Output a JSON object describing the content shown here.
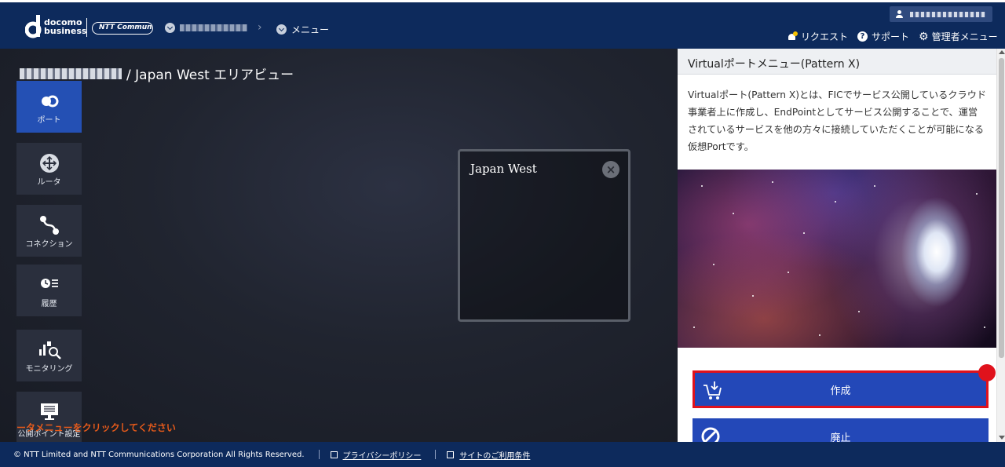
{
  "header": {
    "logo": {
      "line1": "docomo",
      "line2": "business",
      "partner": "NTT Communications"
    },
    "breadcrumb": {
      "menu": "メニュー"
    },
    "links": {
      "request": "リクエスト",
      "support": "サポート",
      "admin_menu": "管理者メニュー"
    },
    "icons": {
      "request": "bell-icon",
      "support": "question-icon",
      "admin": "gear-icon",
      "user": "user-icon"
    }
  },
  "main": {
    "title_suffix": "/ Japan West エリアビュー",
    "sidebar": [
      {
        "key": "port",
        "label": "ポート",
        "icon": "port-icon",
        "active": true
      },
      {
        "key": "router",
        "label": "ルータ",
        "icon": "router-icon",
        "active": false
      },
      {
        "key": "connection",
        "label": "コネクション",
        "icon": "connection-icon",
        "active": false
      },
      {
        "key": "history",
        "label": "履歴",
        "icon": "history-icon",
        "active": false
      },
      {
        "key": "monitoring",
        "label": "モニタリング",
        "icon": "monitoring-icon",
        "active": false
      },
      {
        "key": "public_point",
        "label": "公開ポイント設定",
        "icon": "monitor-icon",
        "active": false
      }
    ],
    "hint": "ータメニューをクリックしてください",
    "area": {
      "name": "Japan West",
      "close_icon": "close-icon"
    }
  },
  "panel": {
    "title": "Virtualポートメニュー(Pattern X)",
    "description": "Virtualポート(Pattern X)とは、FICでサービス公開しているクラウド事業者上に作成し、EndPointとしてサービス公開することで、運営されているサービスを他の方々に接続していただくことが可能になる仮想Portです。",
    "image_icon": "space-wormhole-image",
    "buttons": {
      "create": {
        "label": "作成",
        "icon": "cart-download-icon"
      },
      "abolish": {
        "label": "廃止",
        "icon": "prohibit-icon"
      }
    }
  },
  "footer": {
    "copyright": "© NTT Limited and NTT Communications Corporation All Rights Reserved.",
    "privacy": "プライバシーポリシー",
    "terms": "サイトのご利用条件"
  },
  "colors": {
    "header_bg": "#0d2a5c",
    "accent_blue": "#2348b8",
    "highlight_red": "#e0121c",
    "hint_orange": "#e65a1a"
  }
}
